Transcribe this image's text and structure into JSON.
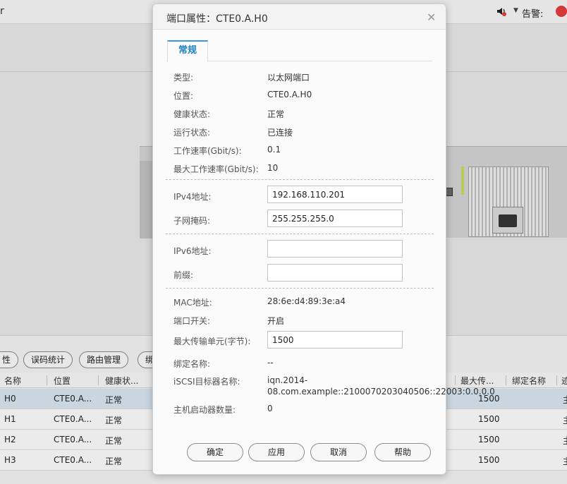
{
  "topbar": {
    "app_title": "r",
    "alarm_label": "告警:"
  },
  "toolbar": {
    "buttons": [
      "性",
      "误码统计",
      "路由管理",
      "绑"
    ]
  },
  "table": {
    "columns": [
      "名称",
      "位置",
      "健康状...",
      "最大传...",
      "绑定名称",
      "迹"
    ],
    "rows": [
      {
        "name": "H0",
        "location": "CTE0.A...",
        "health": "正常",
        "mtu": "1500",
        "tail": "主"
      },
      {
        "name": "H1",
        "location": "CTE0.A...",
        "health": "正常",
        "mtu": "1500",
        "tail": "主"
      },
      {
        "name": "H2",
        "location": "CTE0.A...",
        "health": "正常",
        "mtu": "1500",
        "tail": "主"
      },
      {
        "name": "H3",
        "location": "CTE0.A...",
        "health": "正常",
        "mtu": "1500",
        "tail": "主"
      }
    ]
  },
  "dialog": {
    "title": "端口属性：CTE0.A.H0",
    "tab": "常规",
    "props": {
      "type_label": "类型:",
      "type_value": "以太网端口",
      "location_label": "位置:",
      "location_value": "CTE0.A.H0",
      "health_label": "健康状态:",
      "health_value": "正常",
      "running_label": "运行状态:",
      "running_value": "已连接",
      "speed_label": "工作速率(Gbit/s):",
      "speed_value": "0.1",
      "maxspeed_label": "最大工作速率(Gbit/s):",
      "maxspeed_value": "10",
      "ipv4_label": "IPv4地址:",
      "ipv4_value": "192.168.110.201",
      "mask_label": "子网掩码:",
      "mask_value": "255.255.255.0",
      "ipv6_label": "IPv6地址:",
      "ipv6_value": "",
      "prefix_label": "前缀:",
      "prefix_value": "",
      "mac_label": "MAC地址:",
      "mac_value": "28:6e:d4:89:3e:a4",
      "switch_label": "端口开关:",
      "switch_value": "开启",
      "mtu_label": "最大传输单元(字节):",
      "mtu_value": "1500",
      "bind_label": "绑定名称:",
      "bind_value": "--",
      "iscsi_label": "iSCSI目标器名称:",
      "iscsi_value": "iqn.2014-08.com.example::2100070203040506::22003:0.0.0.0",
      "initiators_label": "主机启动器数量:",
      "initiators_value": "0"
    },
    "buttons": {
      "ok": "确定",
      "apply": "应用",
      "cancel": "取消",
      "help": "帮助"
    }
  },
  "colors": {
    "accent": "#3a9bd9",
    "selected_row": "#d6e4ee",
    "alarm": "#e23c3c"
  }
}
